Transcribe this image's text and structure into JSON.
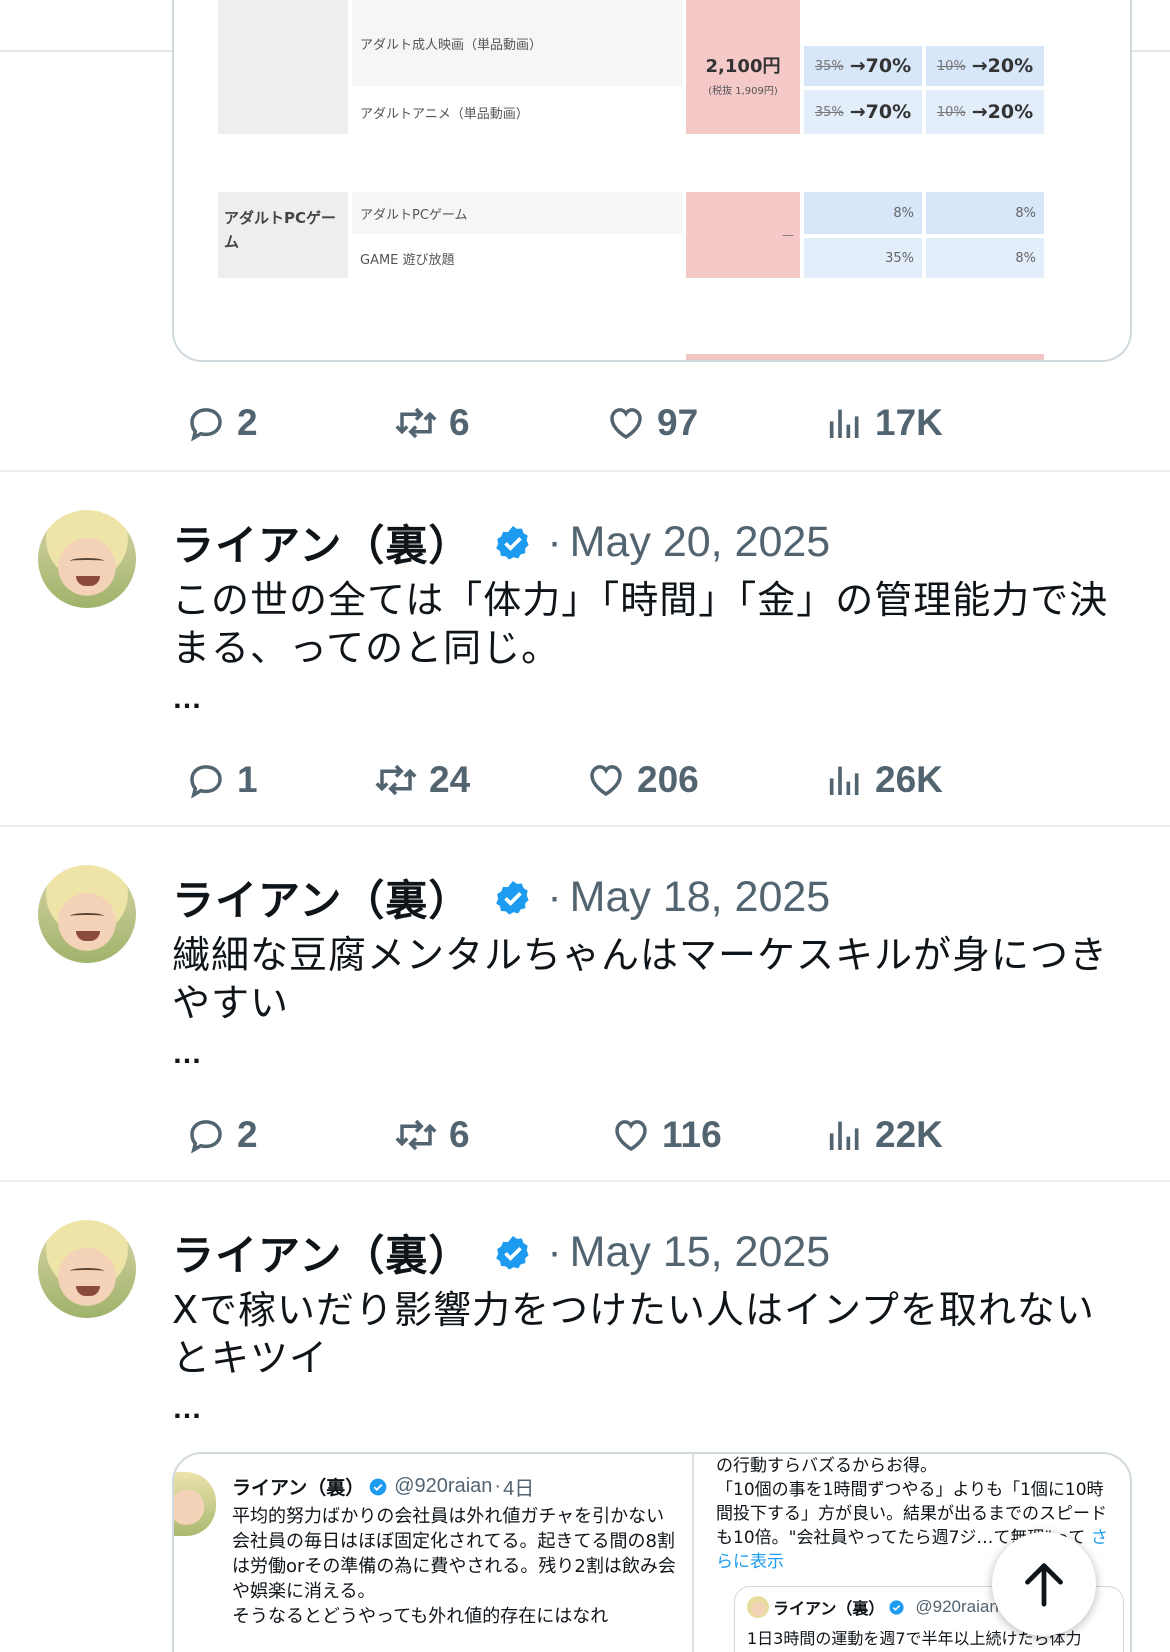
{
  "media_table": {
    "row1_label": "アダルト成人映画（単品動画）",
    "row2_label": "アダルトアニメ（単品動画）",
    "price": "2,100円",
    "price_sub": "(税抜 1,909円)",
    "old_pct_a": "35%",
    "new_pct_a": "70%",
    "old_pct_b": "10%",
    "new_pct_b": "20%",
    "arrow": "→",
    "group2_label": "アダルトPCゲーム",
    "row3_label": "アダルトPCゲーム",
    "row4_label": "GAME 遊び放題",
    "dash": "—",
    "row3_col1": "8%",
    "row3_col2": "8%",
    "row4_col1": "35%",
    "row4_col2": "8%"
  },
  "first_actions": {
    "replies": "2",
    "reposts": "6",
    "likes": "97",
    "views": "17K"
  },
  "tweets": [
    {
      "name": "ライアン（裏）",
      "date": "May 20, 2025",
      "text": "この世の全ては「体力」「時間」「金」の管理能力で決まる、ってのと同じ。",
      "ellipsis": "…",
      "replies": "1",
      "reposts": "24",
      "likes": "206",
      "views": "26K"
    },
    {
      "name": "ライアン（裏）",
      "date": "May 18, 2025",
      "text": "繊細な豆腐メンタルちゃんはマーケスキルが身につきやすい",
      "ellipsis": "…",
      "replies": "2",
      "reposts": "6",
      "likes": "116",
      "views": "22K"
    },
    {
      "name": "ライアン（裏）",
      "date": "May 15, 2025",
      "text": "Xで稼いだり影響力をつけたい人はインプを取れないとキツイ",
      "ellipsis": "…"
    }
  ],
  "meta_separator": "·",
  "quote": {
    "name": "ライアン（裏）",
    "handle": "@920raian",
    "time": "4日",
    "text": "平均的努力ばかりの会社員は外れ値ガチャを引かない\n会社員の毎日はほぼ固定化されてる。起きてる間の8割は労働orその準備の為に費やされる。残り2割は飲み会や娯楽に消える。\nそうなるとどうやっても外れ値的存在にはなれ",
    "right_text": "の行動すらバズるからお得。\n「10個の事を1時間ずつやる」よりも「1個に10時間投下する」方が良い。結果が出るまでのスピードも10倍。\"会社員やってたら週7ジ…て無理\"って",
    "more": "さらに表示",
    "nested_name": "ライアン（裏）",
    "nested_handle": "@920raian",
    "nested_text": "1日3時間の運動を週7で半年以上続けたら体力"
  },
  "colors": {
    "verified": "#1d9bf0",
    "muted": "#536471",
    "text": "#0f1419"
  },
  "icons": [
    "reply-icon",
    "repost-icon",
    "like-icon",
    "views-icon",
    "verified-icon",
    "arrow-up-icon"
  ]
}
